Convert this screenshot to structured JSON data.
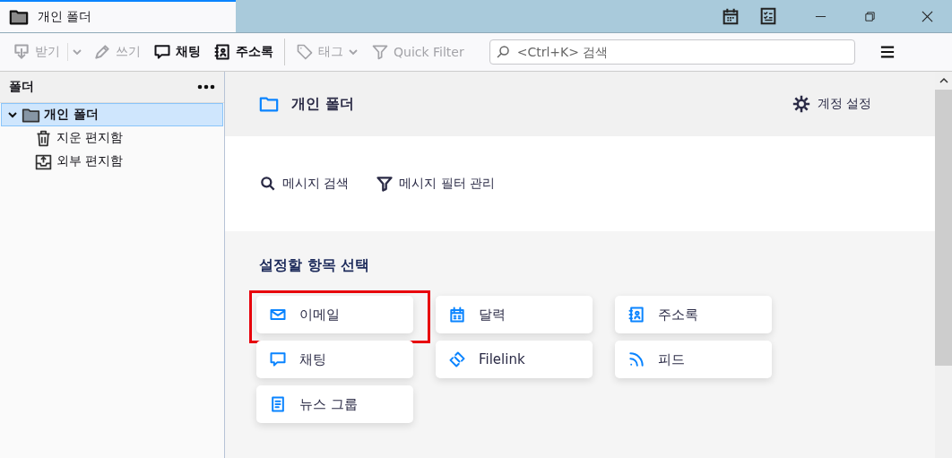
{
  "window": {
    "tab_title": "개인 폴더"
  },
  "toolbar": {
    "buttons": [
      {
        "label": "받기",
        "kind": "get",
        "disabled": true,
        "split": true
      },
      {
        "label": "쓰기",
        "kind": "write",
        "disabled": true
      },
      {
        "label": "채팅",
        "kind": "chat",
        "disabled": false
      },
      {
        "label": "주소록",
        "kind": "addressbook",
        "disabled": false
      }
    ],
    "filter_buttons": [
      {
        "label": "태그",
        "kind": "tag",
        "disabled": true,
        "dropdown": true
      },
      {
        "label": "Quick Filter",
        "kind": "filter",
        "disabled": true
      }
    ],
    "search": {
      "placeholder": "<Ctrl+K> 검색"
    }
  },
  "sidebar": {
    "title": "폴더",
    "tree": [
      {
        "label": "개인 폴더",
        "kind": "folder",
        "selected": true,
        "expanded": true,
        "children": [
          {
            "label": "지운 편지함",
            "kind": "trash",
            "selected": false
          },
          {
            "label": "외부 편지함",
            "kind": "outbox",
            "selected": false
          }
        ]
      }
    ]
  },
  "main": {
    "title": "개인 폴더",
    "account_settings": "계정 설정",
    "actions": [
      {
        "label": "메시지 검색",
        "kind": "search"
      },
      {
        "label": "메시지 필터 관리",
        "kind": "filter"
      }
    ],
    "setup_heading": "설정할 항목 선택",
    "cards": [
      {
        "label": "이메일",
        "kind": "email",
        "highlighted": true
      },
      {
        "label": "달력",
        "kind": "calendar",
        "highlighted": false
      },
      {
        "label": "주소록",
        "kind": "addressbook",
        "highlighted": false
      },
      {
        "label": "채팅",
        "kind": "chat",
        "highlighted": false
      },
      {
        "label": "Filelink",
        "kind": "link",
        "highlighted": false
      },
      {
        "label": "피드",
        "kind": "feed",
        "highlighted": false
      },
      {
        "label": "뉴스 그룹",
        "kind": "news",
        "highlighted": false
      }
    ]
  }
}
